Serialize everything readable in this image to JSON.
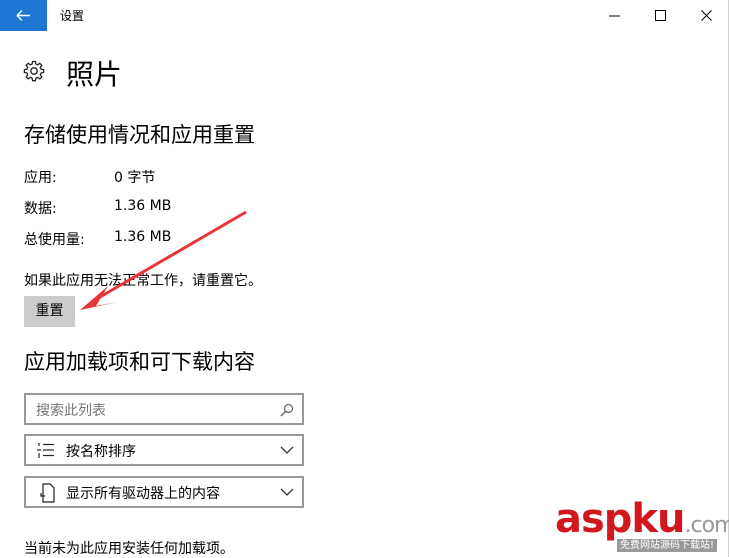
{
  "window": {
    "title": "设置"
  },
  "page": {
    "title": "照片"
  },
  "storage": {
    "heading": "存储使用情况和应用重置",
    "rows": [
      {
        "key": "应用:",
        "value": "0 字节"
      },
      {
        "key": "数据:",
        "value": "1.36 MB"
      },
      {
        "key": "总使用量:",
        "value": "1.36 MB"
      }
    ],
    "reset_hint": "如果此应用无法正常工作，请重置它。",
    "reset_label": "重置"
  },
  "addons": {
    "heading": "应用加载项和可下载内容",
    "search_placeholder": "搜索此列表",
    "sort_label": "按名称排序",
    "drive_label": "显示所有驱动器上的内容",
    "status": "当前未为此应用安装任何加载项。"
  },
  "watermark": {
    "brand": "aspku",
    "suffix": ".com",
    "tagline": "免费网站源码下载站!"
  },
  "colors": {
    "accent": "#1f76d2",
    "arrow": "#e8353b",
    "button": "#cccccc",
    "border": "#999999"
  }
}
